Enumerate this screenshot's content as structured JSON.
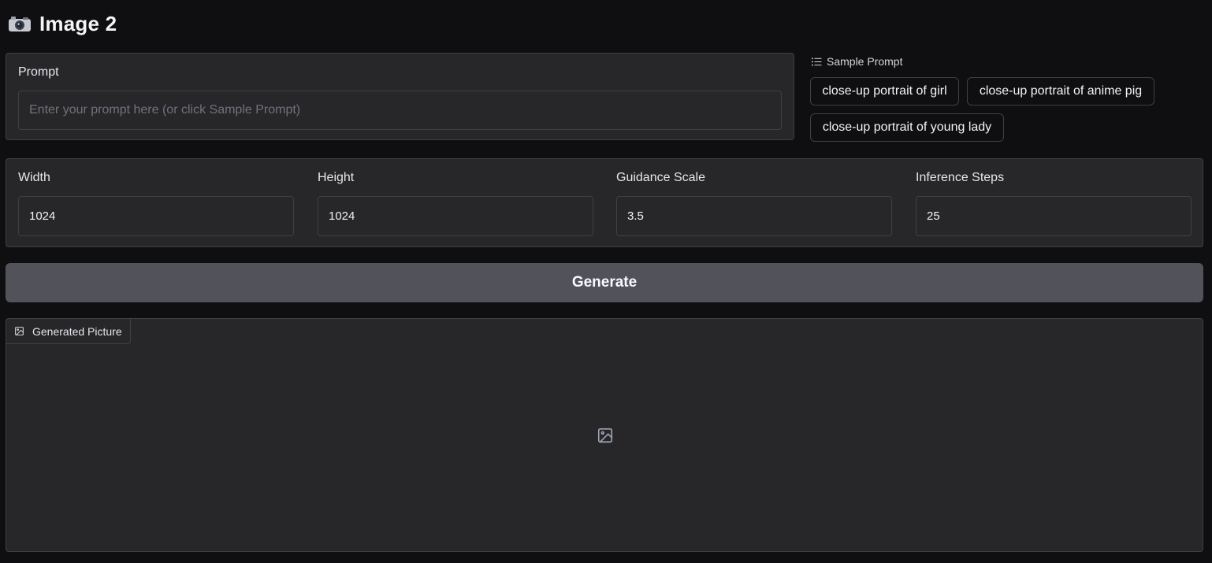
{
  "header": {
    "icon": "camera-icon",
    "title": "Image 2"
  },
  "prompt": {
    "label": "Prompt",
    "value": "",
    "placeholder": "Enter your prompt here (or click Sample Prompt)"
  },
  "samples": {
    "icon": "list-icon",
    "label": "Sample Prompt",
    "items": [
      "close-up portrait of girl",
      "close-up portrait of anime pig",
      "close-up portrait of young lady"
    ]
  },
  "settings": {
    "width": {
      "label": "Width",
      "value": "1024"
    },
    "height": {
      "label": "Height",
      "value": "1024"
    },
    "guidance": {
      "label": "Guidance Scale",
      "value": "3.5"
    },
    "steps": {
      "label": "Inference Steps",
      "value": "25"
    }
  },
  "generate": {
    "label": "Generate"
  },
  "output": {
    "icon": "image-icon",
    "label": "Generated Picture",
    "placeholder_icon": "image-placeholder-icon"
  },
  "colors": {
    "background": "#0f0f11",
    "panel": "#27272a",
    "border": "#3f3f46",
    "button": "#52525b"
  }
}
